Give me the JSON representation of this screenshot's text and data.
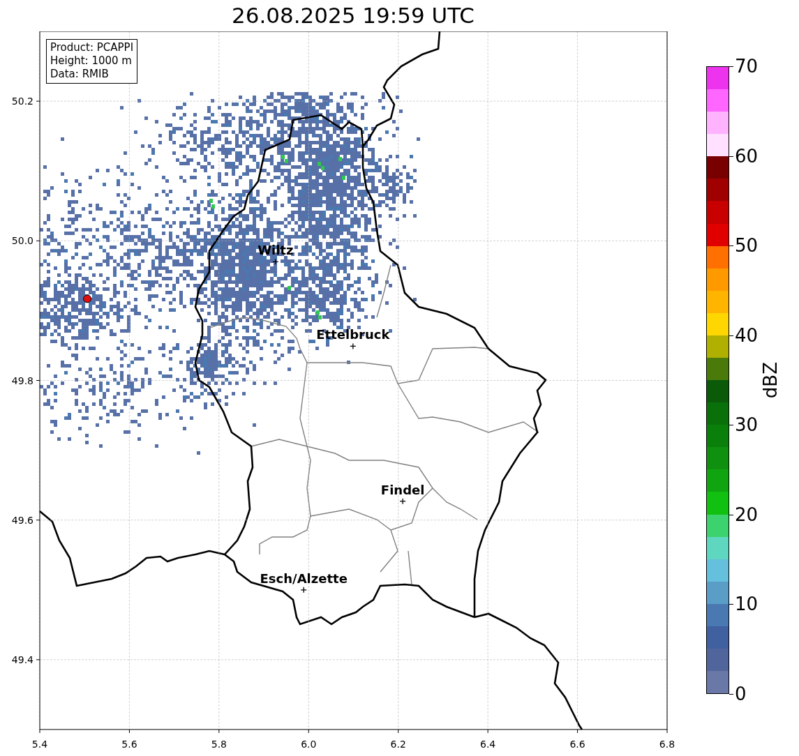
{
  "title": "26.08.2025 19:59 UTC",
  "info_box": [
    "Product: PCAPPI",
    "Height: 1000 m",
    "Data: RMIB"
  ],
  "map": {
    "chart_data": {
      "type": "scatter",
      "x": [
        5.926,
        6.099,
        6.21,
        5.989
      ],
      "values": [
        49.97,
        49.849,
        49.627,
        49.5
      ],
      "grid": true,
      "xlim": [
        5.4,
        6.8
      ],
      "ylim": [
        49.3,
        50.3
      ],
      "xticks": [
        {
          "value": 5.4,
          "label": "5.4"
        },
        {
          "value": 5.6,
          "label": "5.6"
        },
        {
          "value": 5.8,
          "label": "5.8"
        },
        {
          "value": 6,
          "label": "6.0"
        },
        {
          "value": 6.2,
          "label": "6.2"
        },
        {
          "value": 6.4,
          "label": "6.4"
        },
        {
          "value": 6.6,
          "label": "6.6"
        },
        {
          "value": 6.8,
          "label": "6.8"
        }
      ],
      "yticks": [
        {
          "value": 49.4,
          "label": "49.4"
        },
        {
          "value": 49.6,
          "label": "49.6"
        },
        {
          "value": 49.8,
          "label": "49.8"
        },
        {
          "value": 50,
          "label": "50.0"
        },
        {
          "value": 50.2,
          "label": "50.2"
        }
      ],
      "annotations": [
        {
          "x": 5.926,
          "y": 49.97,
          "text": "Wiltz"
        },
        {
          "x": 6.099,
          "y": 49.849,
          "text": "Ettelbruck"
        },
        {
          "x": 6.21,
          "y": 49.627,
          "text": "Findel"
        },
        {
          "x": 5.989,
          "y": 49.5,
          "text": "Esch/Alzette"
        }
      ]
    }
  },
  "colorbar": {
    "label": "dBZ",
    "ticks": [
      "70",
      "60",
      "50",
      "40",
      "30",
      "20",
      "10",
      "0"
    ],
    "bins": [
      {
        "color": "#ee33ee"
      },
      {
        "color": "#ff66ff"
      },
      {
        "color": "#ffb3ff"
      },
      {
        "color": "#ffe0ff"
      },
      {
        "color": "#780000"
      },
      {
        "color": "#a00000"
      },
      {
        "color": "#c80000"
      },
      {
        "color": "#e00000"
      },
      {
        "color": "#ff7000"
      },
      {
        "color": "#ff9900"
      },
      {
        "color": "#ffb400"
      },
      {
        "color": "#ffd700"
      },
      {
        "color": "#b0b000"
      },
      {
        "color": "#4a7a0a"
      },
      {
        "color": "#0a5a0a"
      },
      {
        "color": "#0a700a"
      },
      {
        "color": "#0a800a"
      },
      {
        "color": "#0f900f"
      },
      {
        "color": "#10a510"
      },
      {
        "color": "#12c012"
      },
      {
        "color": "#3cd26e"
      },
      {
        "color": "#5fd6c0"
      },
      {
        "color": "#64c0dc"
      },
      {
        "color": "#5a9ec8"
      },
      {
        "color": "#4a78b0"
      },
      {
        "color": "#4060a0"
      },
      {
        "color": "#50659c"
      },
      {
        "color": "#6a78a8"
      }
    ]
  }
}
